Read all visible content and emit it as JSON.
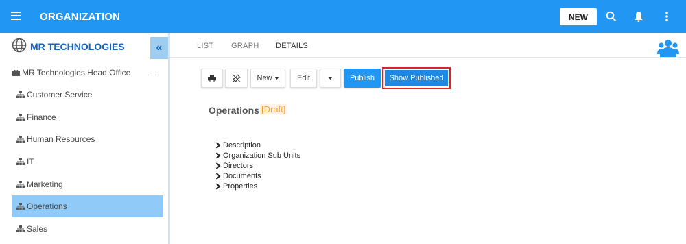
{
  "header": {
    "title": "ORGANIZATION",
    "new_label": "NEW"
  },
  "sidebar": {
    "org_name": "MR TECHNOLOGIES",
    "collapse_glyph": "«",
    "root": {
      "label": "MR Technologies Head Office",
      "toggle": "–"
    },
    "items": [
      {
        "label": "Customer Service"
      },
      {
        "label": "Finance"
      },
      {
        "label": "Human Resources"
      },
      {
        "label": "IT"
      },
      {
        "label": "Marketing"
      },
      {
        "label": "Operations",
        "active": true
      },
      {
        "label": "Sales"
      }
    ]
  },
  "tabs": [
    {
      "label": "LIST"
    },
    {
      "label": "GRAPH"
    },
    {
      "label": "DETAILS",
      "active": true
    }
  ],
  "toolbar": {
    "print_icon": "print-icon",
    "unpin_icon": "pin-off-icon",
    "new_label": "New",
    "edit_label": "Edit",
    "publish_label": "Publish",
    "show_published_label": "Show Published"
  },
  "detail": {
    "title": "Operations",
    "status": "[Draft]",
    "sections": [
      "Description",
      "Organization Sub Units",
      "Directors",
      "Documents",
      "Properties"
    ]
  },
  "colors": {
    "primary": "#2196f3",
    "sidebar_active": "#90caf9",
    "draft": "#f5a623",
    "highlight": "#e0202a"
  }
}
